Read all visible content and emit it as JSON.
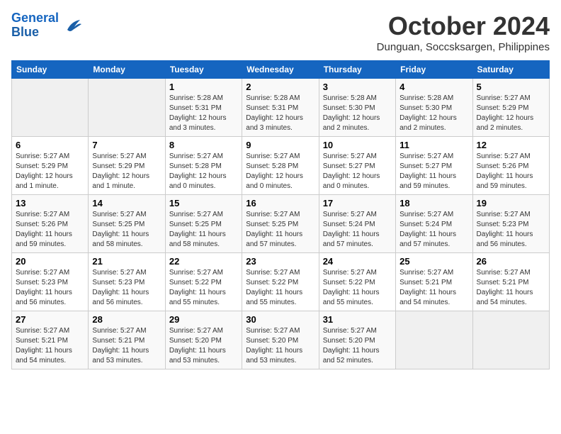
{
  "logo": {
    "line1": "General",
    "line2": "Blue"
  },
  "title": "October 2024",
  "subtitle": "Dunguan, Soccsksargen, Philippines",
  "headers": [
    "Sunday",
    "Monday",
    "Tuesday",
    "Wednesday",
    "Thursday",
    "Friday",
    "Saturday"
  ],
  "weeks": [
    [
      {
        "day": "",
        "sunrise": "",
        "sunset": "",
        "daylight": ""
      },
      {
        "day": "",
        "sunrise": "",
        "sunset": "",
        "daylight": ""
      },
      {
        "day": "1",
        "sunrise": "Sunrise: 5:28 AM",
        "sunset": "Sunset: 5:31 PM",
        "daylight": "Daylight: 12 hours and 3 minutes."
      },
      {
        "day": "2",
        "sunrise": "Sunrise: 5:28 AM",
        "sunset": "Sunset: 5:31 PM",
        "daylight": "Daylight: 12 hours and 3 minutes."
      },
      {
        "day": "3",
        "sunrise": "Sunrise: 5:28 AM",
        "sunset": "Sunset: 5:30 PM",
        "daylight": "Daylight: 12 hours and 2 minutes."
      },
      {
        "day": "4",
        "sunrise": "Sunrise: 5:28 AM",
        "sunset": "Sunset: 5:30 PM",
        "daylight": "Daylight: 12 hours and 2 minutes."
      },
      {
        "day": "5",
        "sunrise": "Sunrise: 5:27 AM",
        "sunset": "Sunset: 5:29 PM",
        "daylight": "Daylight: 12 hours and 2 minutes."
      }
    ],
    [
      {
        "day": "6",
        "sunrise": "Sunrise: 5:27 AM",
        "sunset": "Sunset: 5:29 PM",
        "daylight": "Daylight: 12 hours and 1 minute."
      },
      {
        "day": "7",
        "sunrise": "Sunrise: 5:27 AM",
        "sunset": "Sunset: 5:29 PM",
        "daylight": "Daylight: 12 hours and 1 minute."
      },
      {
        "day": "8",
        "sunrise": "Sunrise: 5:27 AM",
        "sunset": "Sunset: 5:28 PM",
        "daylight": "Daylight: 12 hours and 0 minutes."
      },
      {
        "day": "9",
        "sunrise": "Sunrise: 5:27 AM",
        "sunset": "Sunset: 5:28 PM",
        "daylight": "Daylight: 12 hours and 0 minutes."
      },
      {
        "day": "10",
        "sunrise": "Sunrise: 5:27 AM",
        "sunset": "Sunset: 5:27 PM",
        "daylight": "Daylight: 12 hours and 0 minutes."
      },
      {
        "day": "11",
        "sunrise": "Sunrise: 5:27 AM",
        "sunset": "Sunset: 5:27 PM",
        "daylight": "Daylight: 11 hours and 59 minutes."
      },
      {
        "day": "12",
        "sunrise": "Sunrise: 5:27 AM",
        "sunset": "Sunset: 5:26 PM",
        "daylight": "Daylight: 11 hours and 59 minutes."
      }
    ],
    [
      {
        "day": "13",
        "sunrise": "Sunrise: 5:27 AM",
        "sunset": "Sunset: 5:26 PM",
        "daylight": "Daylight: 11 hours and 59 minutes."
      },
      {
        "day": "14",
        "sunrise": "Sunrise: 5:27 AM",
        "sunset": "Sunset: 5:25 PM",
        "daylight": "Daylight: 11 hours and 58 minutes."
      },
      {
        "day": "15",
        "sunrise": "Sunrise: 5:27 AM",
        "sunset": "Sunset: 5:25 PM",
        "daylight": "Daylight: 11 hours and 58 minutes."
      },
      {
        "day": "16",
        "sunrise": "Sunrise: 5:27 AM",
        "sunset": "Sunset: 5:25 PM",
        "daylight": "Daylight: 11 hours and 57 minutes."
      },
      {
        "day": "17",
        "sunrise": "Sunrise: 5:27 AM",
        "sunset": "Sunset: 5:24 PM",
        "daylight": "Daylight: 11 hours and 57 minutes."
      },
      {
        "day": "18",
        "sunrise": "Sunrise: 5:27 AM",
        "sunset": "Sunset: 5:24 PM",
        "daylight": "Daylight: 11 hours and 57 minutes."
      },
      {
        "day": "19",
        "sunrise": "Sunrise: 5:27 AM",
        "sunset": "Sunset: 5:23 PM",
        "daylight": "Daylight: 11 hours and 56 minutes."
      }
    ],
    [
      {
        "day": "20",
        "sunrise": "Sunrise: 5:27 AM",
        "sunset": "Sunset: 5:23 PM",
        "daylight": "Daylight: 11 hours and 56 minutes."
      },
      {
        "day": "21",
        "sunrise": "Sunrise: 5:27 AM",
        "sunset": "Sunset: 5:23 PM",
        "daylight": "Daylight: 11 hours and 56 minutes."
      },
      {
        "day": "22",
        "sunrise": "Sunrise: 5:27 AM",
        "sunset": "Sunset: 5:22 PM",
        "daylight": "Daylight: 11 hours and 55 minutes."
      },
      {
        "day": "23",
        "sunrise": "Sunrise: 5:27 AM",
        "sunset": "Sunset: 5:22 PM",
        "daylight": "Daylight: 11 hours and 55 minutes."
      },
      {
        "day": "24",
        "sunrise": "Sunrise: 5:27 AM",
        "sunset": "Sunset: 5:22 PM",
        "daylight": "Daylight: 11 hours and 55 minutes."
      },
      {
        "day": "25",
        "sunrise": "Sunrise: 5:27 AM",
        "sunset": "Sunset: 5:21 PM",
        "daylight": "Daylight: 11 hours and 54 minutes."
      },
      {
        "day": "26",
        "sunrise": "Sunrise: 5:27 AM",
        "sunset": "Sunset: 5:21 PM",
        "daylight": "Daylight: 11 hours and 54 minutes."
      }
    ],
    [
      {
        "day": "27",
        "sunrise": "Sunrise: 5:27 AM",
        "sunset": "Sunset: 5:21 PM",
        "daylight": "Daylight: 11 hours and 54 minutes."
      },
      {
        "day": "28",
        "sunrise": "Sunrise: 5:27 AM",
        "sunset": "Sunset: 5:21 PM",
        "daylight": "Daylight: 11 hours and 53 minutes."
      },
      {
        "day": "29",
        "sunrise": "Sunrise: 5:27 AM",
        "sunset": "Sunset: 5:20 PM",
        "daylight": "Daylight: 11 hours and 53 minutes."
      },
      {
        "day": "30",
        "sunrise": "Sunrise: 5:27 AM",
        "sunset": "Sunset: 5:20 PM",
        "daylight": "Daylight: 11 hours and 53 minutes."
      },
      {
        "day": "31",
        "sunrise": "Sunrise: 5:27 AM",
        "sunset": "Sunset: 5:20 PM",
        "daylight": "Daylight: 11 hours and 52 minutes."
      },
      {
        "day": "",
        "sunrise": "",
        "sunset": "",
        "daylight": ""
      },
      {
        "day": "",
        "sunrise": "",
        "sunset": "",
        "daylight": ""
      }
    ]
  ]
}
